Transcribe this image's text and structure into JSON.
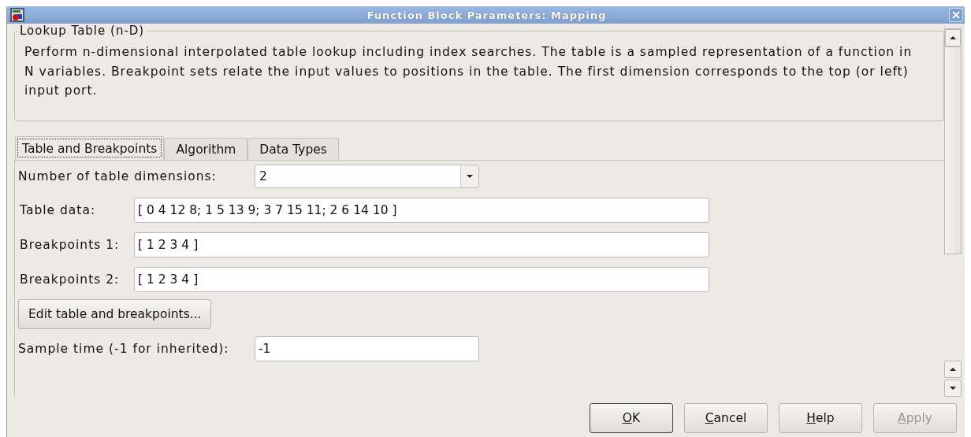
{
  "window": {
    "title": "Function Block Parameters: Mapping"
  },
  "group": {
    "title": "Lookup Table (n-D)",
    "description": "Perform n-dimensional interpolated table lookup including index searches. The  table is a sampled representation of a function in N variables. Breakpoint sets relate the input values to positions in the table. The first dimension corresponds to the top (or left) input port."
  },
  "tabs": [
    {
      "label": "Table and Breakpoints",
      "selected": true
    },
    {
      "label": "Algorithm",
      "selected": false
    },
    {
      "label": "Data Types",
      "selected": false
    }
  ],
  "fields": [
    {
      "kind": "dropdown",
      "label": "Number of table dimensions:",
      "value": "2"
    },
    {
      "kind": "text",
      "label": "Table data:",
      "value": "[ 0 4 12 8; 1 5 13 9; 3 7 15 11; 2 6 14 10 ]"
    },
    {
      "kind": "text",
      "label": "Breakpoints 1:",
      "value": "[ 1 2 3 4 ]"
    },
    {
      "kind": "text",
      "label": "Breakpoints 2:",
      "value": "[ 1 2 3 4 ]"
    },
    {
      "kind": "button",
      "label": "Edit table and breakpoints..."
    },
    {
      "kind": "short",
      "label": "Sample time (-1 for inherited):",
      "value": "-1"
    }
  ],
  "buttons": [
    {
      "label": "OK",
      "default": true,
      "disabled": false
    },
    {
      "label": "Cancel",
      "default": false,
      "disabled": false
    },
    {
      "label": "Help",
      "default": false,
      "disabled": false
    },
    {
      "label": "Apply",
      "default": false,
      "disabled": true
    }
  ]
}
